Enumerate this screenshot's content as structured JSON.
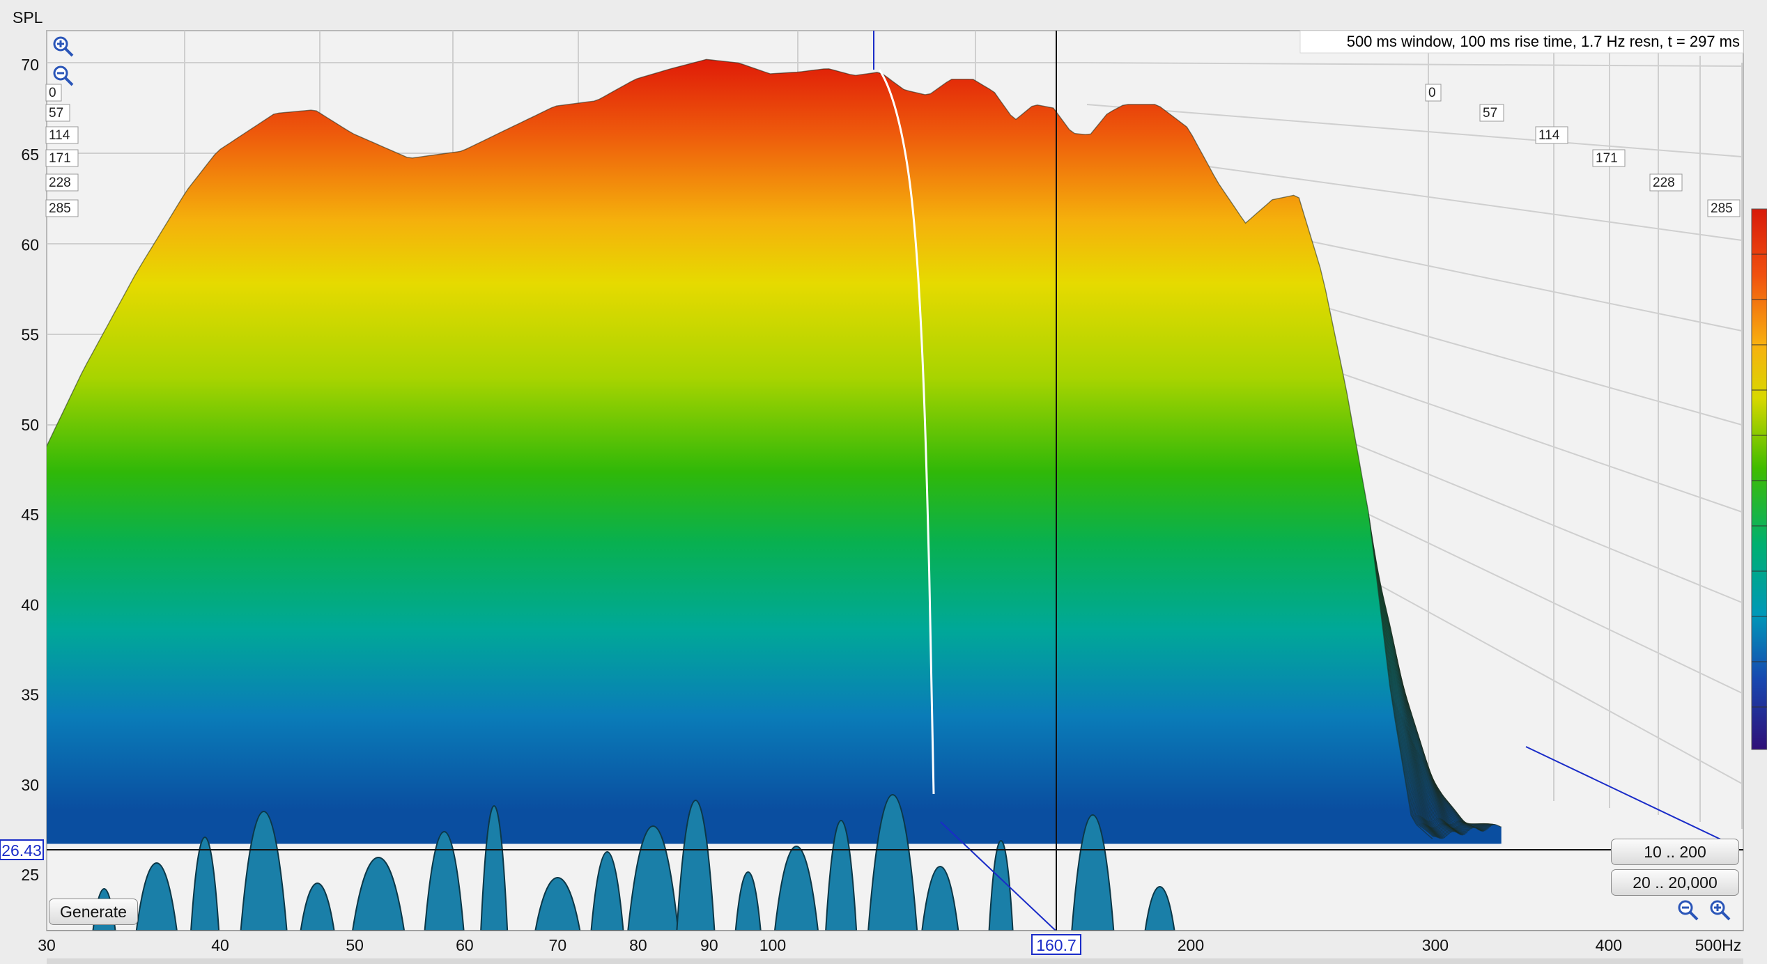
{
  "chart_data": {
    "type": "waterfall",
    "yaxis_title": "SPL",
    "x_unit": "Hz",
    "xscale": "log",
    "xlim": [
      30,
      500
    ],
    "ylim": [
      21,
      72
    ],
    "y_ticks": [
      25,
      30,
      35,
      40,
      45,
      50,
      55,
      60,
      65,
      70
    ],
    "x_ticks": [
      "30",
      "40",
      "50",
      "60",
      "70",
      "80",
      "90",
      "100",
      "200",
      "300",
      "400",
      "500"
    ],
    "time_ticks_left": [
      "0",
      "57",
      "114",
      "171",
      "228",
      "285"
    ],
    "time_ticks_right": [
      "0",
      "57",
      "114",
      "171",
      "228",
      "285"
    ],
    "info_text": "500 ms window, 100 ms rise time,  1.7 Hz resn, t = 297 ms",
    "cursor_spl": "26.43",
    "cursor_freq": "160.7",
    "front_slice_hz": [
      30,
      32,
      35,
      38,
      40,
      44,
      47,
      50,
      55,
      60,
      65,
      70,
      75,
      80,
      85,
      90,
      95,
      100,
      105,
      110,
      115,
      120,
      125,
      130,
      135,
      140,
      145,
      150,
      155,
      160,
      165,
      170,
      175,
      180,
      190,
      200,
      210,
      220,
      230,
      240,
      250,
      260,
      270,
      280,
      290,
      300
    ],
    "front_slice_spl": [
      48.5,
      53,
      58.5,
      63,
      65.2,
      67.3,
      67.5,
      66.2,
      64.8,
      65.2,
      66.5,
      67.7,
      68,
      69.2,
      69.8,
      70.3,
      70.1,
      69.5,
      69.6,
      69.8,
      69.4,
      69.6,
      68.6,
      68.3,
      69.2,
      69.2,
      68.5,
      66.9,
      67.8,
      67.6,
      66.2,
      66.1,
      67.3,
      67.8,
      67.8,
      66.5,
      63.5,
      61.2,
      62.5,
      62.8,
      58.3,
      52,
      45,
      35,
      28,
      27
    ],
    "decay_floor_spl": 27.5,
    "slice_count": 60,
    "colorbar": [
      "#d81a0a",
      "#f04a10",
      "#f8a010",
      "#e8dc00",
      "#b8d800",
      "#60c400",
      "#10b020",
      "#00b070",
      "#00a0a8",
      "#1068c0",
      "#1830a8",
      "#301078"
    ]
  },
  "controls": {
    "generate_label": "Generate",
    "range1_label": "10 .. 200",
    "range2_label": "20 .. 20,000"
  }
}
